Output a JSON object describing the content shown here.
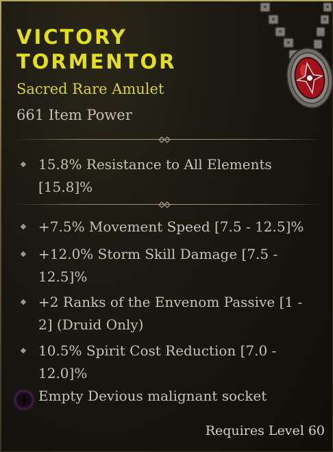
{
  "item": {
    "name_line1": "VICTORY",
    "name_line2": "TORMENTOR",
    "type": "Sacred Rare Amulet",
    "power": "661 Item Power",
    "rarity_color": "#e3df1c"
  },
  "implicit": [
    {
      "line1": "15.8% Resistance to All Elements",
      "line2": "[15.8]%"
    }
  ],
  "affixes": [
    {
      "line1": "+7.5% Movement Speed [7.5 - 12.5]%",
      "line2": ""
    },
    {
      "line1": "+12.0% Storm Skill Damage [7.5 -",
      "line2": "12.5]%"
    },
    {
      "line1": "+2 Ranks of the Envenom Passive [1 -",
      "line2": "2] (Druid Only)"
    },
    {
      "line1": "10.5% Spirit Cost Reduction [7.0 -",
      "line2": "12.0]%"
    }
  ],
  "socket": {
    "text": "Empty Devious malignant socket",
    "icon": "malignant-socket-icon"
  },
  "requirement": "Requires Level 60",
  "icons": {
    "item": "amulet-icon",
    "divider": "divider-ornament-icon"
  }
}
